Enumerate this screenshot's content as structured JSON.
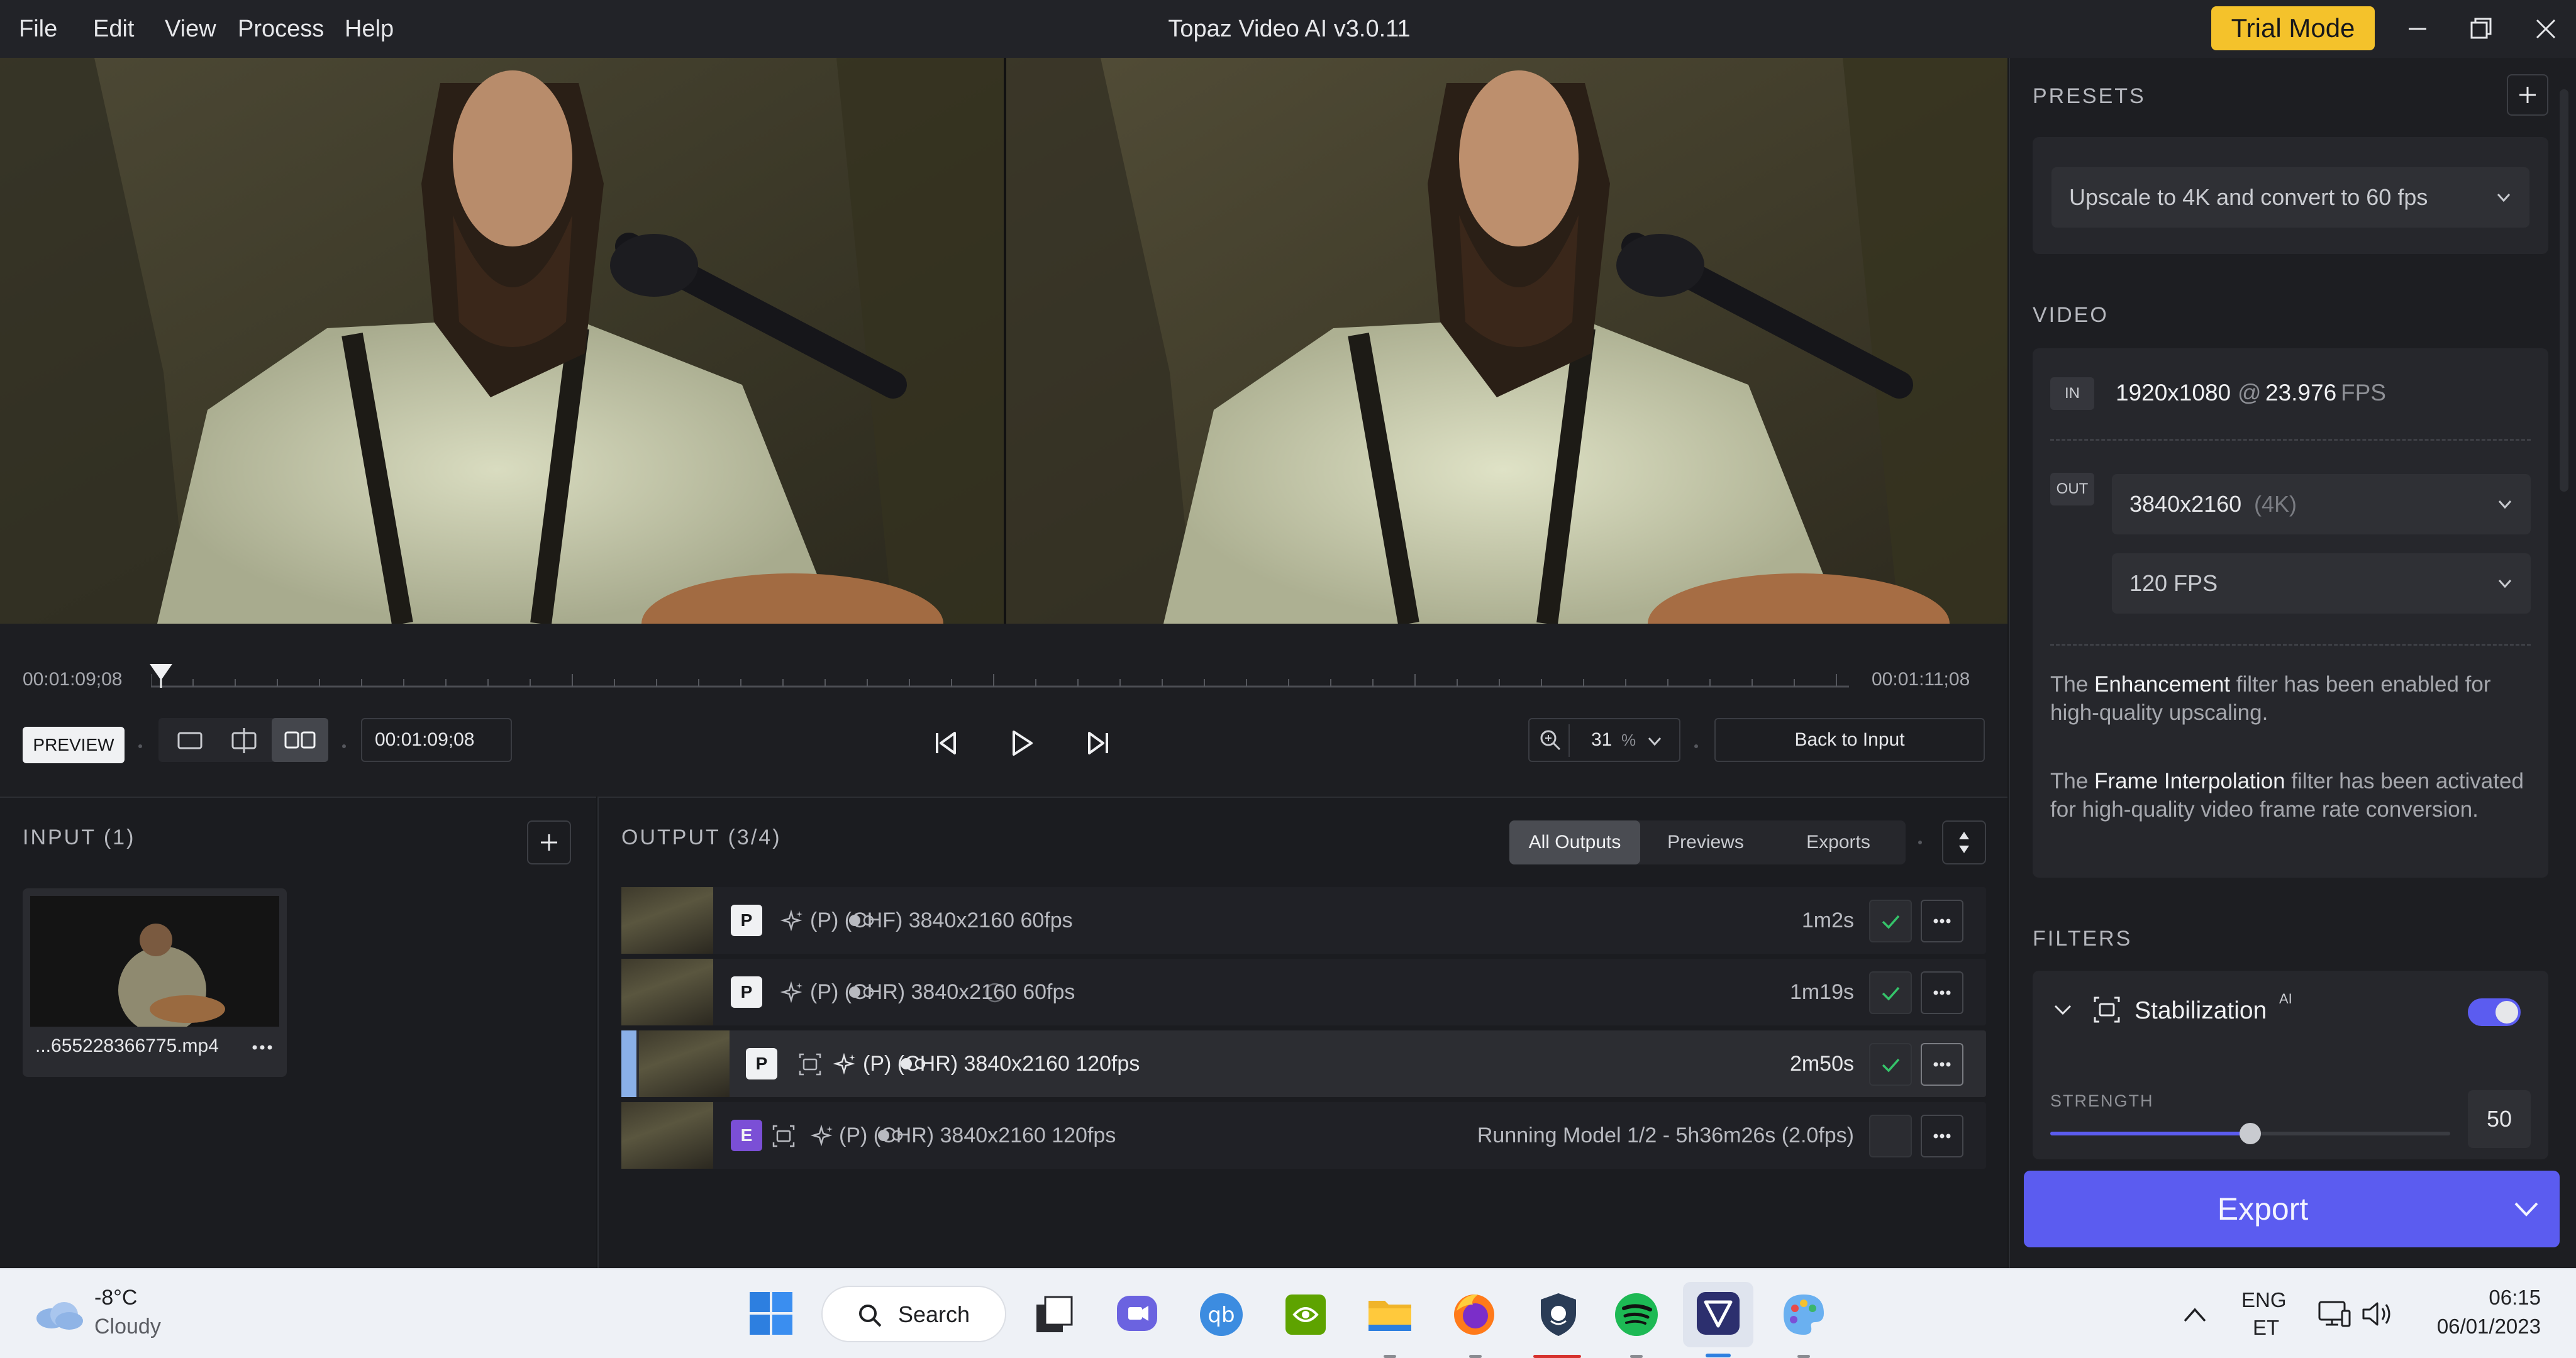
{
  "menu": [
    "File",
    "Edit",
    "View",
    "Process",
    "Help"
  ],
  "window_title": "Topaz Video AI  v3.0.11",
  "trial_label": "Trial Mode",
  "timeline": {
    "start_tc": "00:01:09;08",
    "end_tc": "00:01:11;08",
    "preview_label": "PREVIEW",
    "current_tc": "00:01:09;08",
    "zoom": "31",
    "zoom_unit": "%",
    "back_label": "Back to Input"
  },
  "input": {
    "header": "INPUT (1)",
    "file_name": "...655228366775.mp4"
  },
  "output": {
    "header": "OUTPUT (3/4)",
    "tabs": [
      "All Outputs",
      "Previews",
      "Exports"
    ],
    "rows": [
      {
        "badge": "P",
        "text": "(P)   (CHF)   3840x2160   60fps",
        "status": "1m2s"
      },
      {
        "badge": "P",
        "text": "(P)   (CHR)         3840x2160   60fps",
        "status": "1m19s"
      },
      {
        "badge": "P",
        "text": "(P)   (CHR)   3840x2160   120fps",
        "status": "2m50s"
      },
      {
        "badge": "E",
        "text": "(P)   (CHR)   3840x2160   120fps",
        "status": "Running Model   1/2 -  5h36m26s (2.0fps)"
      }
    ]
  },
  "presets": {
    "header": "PRESETS",
    "selected": "Upscale to 4K and convert to 60 fps"
  },
  "video": {
    "header": "VIDEO",
    "in_tag": "IN",
    "in_res": "1920x1080",
    "in_at": "@",
    "in_fps": "23.976",
    "in_fps_unit": "FPS",
    "out_tag": "OUT",
    "out_res": "3840x2160",
    "out_res_note": "(4K)",
    "out_fps": "120 FPS",
    "note1_pre": "The ",
    "note1_bold": "Enhancement",
    "note1_post": " filter has been enabled for high-quality upscaling.",
    "note2_pre": "The ",
    "note2_bold": "Frame Interpolation",
    "note2_post": " filter has been activated for high-quality video frame rate conversion."
  },
  "filters": {
    "header": "FILTERS",
    "stabilization_label": "Stabilization",
    "ai_tag": "AI",
    "stabilization_enabled": true,
    "strength_label": "STRENGTH",
    "strength_value": "50",
    "strength_fraction": 0.5
  },
  "export_label": "Export",
  "taskbar": {
    "weather_temp": "-8°C",
    "weather_desc": "Cloudy",
    "search_label": "Search",
    "lang1": "ENG",
    "lang2": "ET",
    "time": "06:15",
    "date": "06/01/2023"
  },
  "colors": {
    "accent": "#5b5cf0",
    "trial": "#f4c22b",
    "check": "#35c46a",
    "export_badge": "#7b4fd6"
  }
}
